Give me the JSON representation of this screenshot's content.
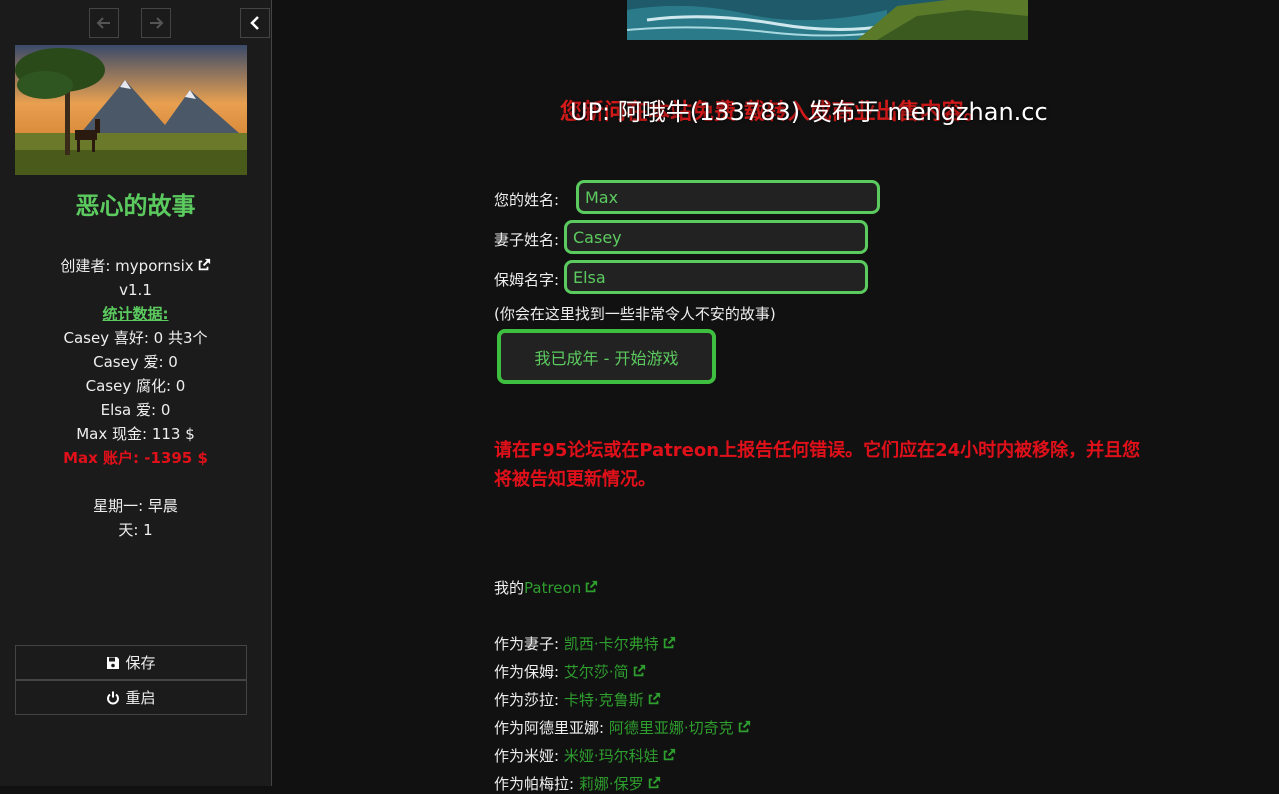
{
  "sidebar": {
    "story_title": "恶心的故事",
    "creator_label": "创建者: mypornsix",
    "version": "v1.1",
    "stats_header": "统计数据:",
    "stats": [
      "Casey 喜好: 0 共3个",
      "Casey 爱: 0",
      "Casey 腐化: 0",
      "Elsa 爱: 0",
      "Max 现金: 113 $"
    ],
    "debt": "Max 账户: -1395 $",
    "time": "星期一: 早晨",
    "day": "天: 1",
    "save_label": "保存",
    "restart_label": "重启"
  },
  "main": {
    "up_notice_over": "UP: 阿哦牛(133783) 发布于 mengzhan.cc",
    "up_notice_under": "您新问在本站免费 载转入或商业出售内容。",
    "form": {
      "your_name_label": "您的姓名:",
      "your_name_value": "Max",
      "wife_name_label": "妻子姓名:",
      "wife_name_value": "Casey",
      "nanny_name_label": "保姆名字:",
      "nanny_name_value": "Elsa"
    },
    "note": "(你会在这里找到一些非常令人不安的故事)",
    "start_button": "我已成年 - 开始游戏",
    "bug_report": "请在F95论坛或在Patreon上报告任何错误。它们应在24小时内被移除，并且您将被告知更新情况。",
    "my_patreon_prefix": "我的",
    "my_patreon_link": "Patreon",
    "credits": [
      {
        "role": "作为妻子:",
        "name": "凯西·卡尔弗特"
      },
      {
        "role": "作为保姆:",
        "name": "艾尔莎·简"
      },
      {
        "role": "作为莎拉:",
        "name": "卡特·克鲁斯"
      },
      {
        "role": "作为阿德里亚娜:",
        "name": "阿德里亚娜·切奇克"
      },
      {
        "role": "作为米娅:",
        "name": "米娅·玛尔科娃"
      },
      {
        "role": "作为帕梅拉:",
        "name": "莉娜·保罗"
      }
    ]
  },
  "colors": {
    "accent_green": "#5ccb5f",
    "link_green": "#2e9e2e",
    "warning_red": "#e0101a",
    "background": "#111111",
    "sidebar_bg": "#1b1b1b"
  },
  "icons": [
    "arrow-left-icon",
    "arrow-right-icon",
    "chevron-left-icon",
    "external-link-icon",
    "save-icon",
    "power-icon"
  ]
}
